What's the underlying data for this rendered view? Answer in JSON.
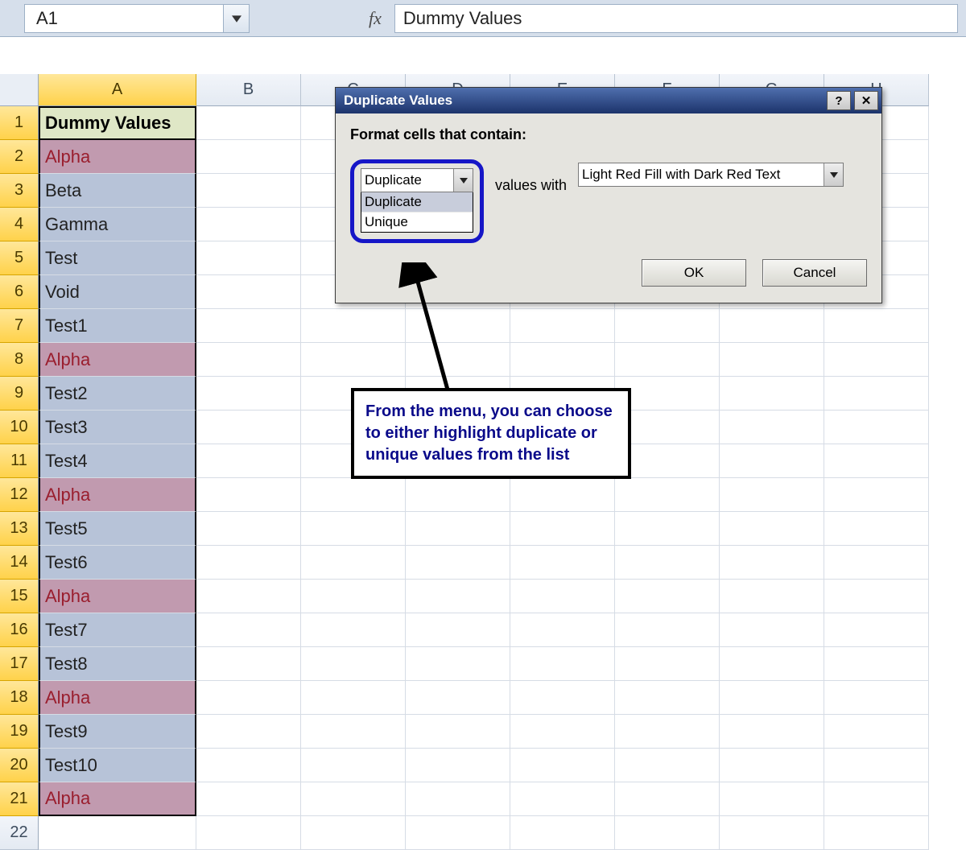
{
  "formula_bar": {
    "cell_ref": "A1",
    "fx_label": "fx",
    "value": "Dummy Values"
  },
  "columns": [
    "A",
    "B",
    "C",
    "D",
    "E",
    "F",
    "G",
    "H"
  ],
  "selected_col": "A",
  "rows": [
    {
      "n": 1,
      "val": "Dummy Values",
      "cls": "header-cell colA-border"
    },
    {
      "n": 2,
      "val": "Alpha",
      "cls": "dup-fill colA-border"
    },
    {
      "n": 3,
      "val": "Beta",
      "cls": "sel-fill colA-border"
    },
    {
      "n": 4,
      "val": "Gamma",
      "cls": "sel-fill colA-border"
    },
    {
      "n": 5,
      "val": "Test",
      "cls": "sel-fill colA-border"
    },
    {
      "n": 6,
      "val": "Void",
      "cls": "sel-fill colA-border"
    },
    {
      "n": 7,
      "val": "Test1",
      "cls": "sel-fill colA-border"
    },
    {
      "n": 8,
      "val": "Alpha",
      "cls": "dup-fill colA-border"
    },
    {
      "n": 9,
      "val": "Test2",
      "cls": "sel-fill colA-border"
    },
    {
      "n": 10,
      "val": "Test3",
      "cls": "sel-fill colA-border"
    },
    {
      "n": 11,
      "val": "Test4",
      "cls": "sel-fill colA-border"
    },
    {
      "n": 12,
      "val": "Alpha",
      "cls": "dup-fill colA-border"
    },
    {
      "n": 13,
      "val": "Test5",
      "cls": "sel-fill colA-border"
    },
    {
      "n": 14,
      "val": "Test6",
      "cls": "sel-fill colA-border"
    },
    {
      "n": 15,
      "val": "Alpha",
      "cls": "dup-fill colA-border"
    },
    {
      "n": 16,
      "val": "Test7",
      "cls": "sel-fill colA-border"
    },
    {
      "n": 17,
      "val": "Test8",
      "cls": "sel-fill colA-border"
    },
    {
      "n": 18,
      "val": "Alpha",
      "cls": "dup-fill colA-border"
    },
    {
      "n": 19,
      "val": "Test9",
      "cls": "sel-fill colA-border"
    },
    {
      "n": 20,
      "val": "Test10",
      "cls": "sel-fill colA-border"
    },
    {
      "n": 21,
      "val": "Alpha",
      "cls": "dup-fill colA-border colA-border-bottom"
    },
    {
      "n": 22,
      "val": "",
      "cls": ""
    }
  ],
  "dialog": {
    "title": "Duplicate Values",
    "label": "Format cells that contain:",
    "combo1_value": "Duplicate",
    "combo1_options": [
      "Duplicate",
      "Unique"
    ],
    "values_with": "values with",
    "combo2_value": "Light Red Fill with Dark Red Text",
    "ok": "OK",
    "cancel": "Cancel",
    "help_glyph": "?",
    "close_glyph": "✕"
  },
  "callout_text": "From the menu, you can choose to either highlight duplicate or unique values from the list"
}
